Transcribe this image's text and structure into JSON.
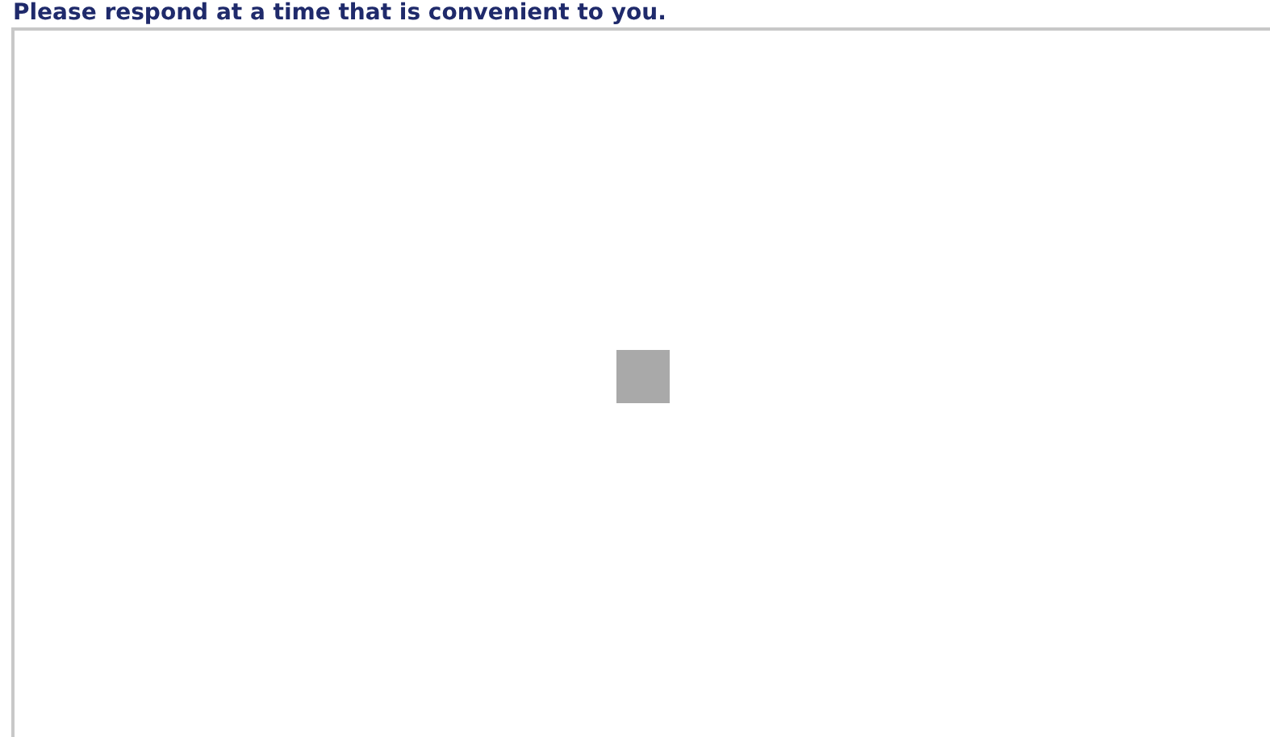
{
  "heading": "Please respond at a time that is convenient to you."
}
